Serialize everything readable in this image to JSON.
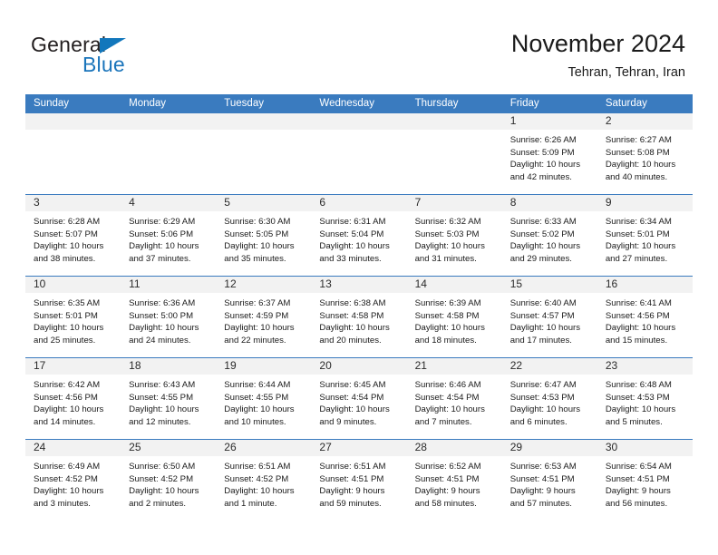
{
  "logo": {
    "word_one": "General",
    "word_two": "Blue",
    "triangle_icon": "blue-triangle-icon",
    "color_dark": "#231f20",
    "color_blue": "#1b75bb"
  },
  "header": {
    "title": "November 2024",
    "subtitle": "Tehran, Tehran, Iran",
    "accent_color": "#3a7bbf",
    "datenum_bg": "#f2f2f2"
  },
  "weekdays": [
    "Sunday",
    "Monday",
    "Tuesday",
    "Wednesday",
    "Thursday",
    "Friday",
    "Saturday"
  ],
  "labels": {
    "sunrise": "Sunrise:",
    "sunset": "Sunset:",
    "daylight": "Daylight:"
  },
  "weeks": [
    [
      {
        "day": "",
        "empty": true
      },
      {
        "day": "",
        "empty": true
      },
      {
        "day": "",
        "empty": true
      },
      {
        "day": "",
        "empty": true
      },
      {
        "day": "",
        "empty": true
      },
      {
        "day": "1",
        "sunrise": "Sunrise: 6:26 AM",
        "sunset": "Sunset: 5:09 PM",
        "daylight": "Daylight: 10 hours and 42 minutes."
      },
      {
        "day": "2",
        "sunrise": "Sunrise: 6:27 AM",
        "sunset": "Sunset: 5:08 PM",
        "daylight": "Daylight: 10 hours and 40 minutes."
      }
    ],
    [
      {
        "day": "3",
        "sunrise": "Sunrise: 6:28 AM",
        "sunset": "Sunset: 5:07 PM",
        "daylight": "Daylight: 10 hours and 38 minutes."
      },
      {
        "day": "4",
        "sunrise": "Sunrise: 6:29 AM",
        "sunset": "Sunset: 5:06 PM",
        "daylight": "Daylight: 10 hours and 37 minutes."
      },
      {
        "day": "5",
        "sunrise": "Sunrise: 6:30 AM",
        "sunset": "Sunset: 5:05 PM",
        "daylight": "Daylight: 10 hours and 35 minutes."
      },
      {
        "day": "6",
        "sunrise": "Sunrise: 6:31 AM",
        "sunset": "Sunset: 5:04 PM",
        "daylight": "Daylight: 10 hours and 33 minutes."
      },
      {
        "day": "7",
        "sunrise": "Sunrise: 6:32 AM",
        "sunset": "Sunset: 5:03 PM",
        "daylight": "Daylight: 10 hours and 31 minutes."
      },
      {
        "day": "8",
        "sunrise": "Sunrise: 6:33 AM",
        "sunset": "Sunset: 5:02 PM",
        "daylight": "Daylight: 10 hours and 29 minutes."
      },
      {
        "day": "9",
        "sunrise": "Sunrise: 6:34 AM",
        "sunset": "Sunset: 5:01 PM",
        "daylight": "Daylight: 10 hours and 27 minutes."
      }
    ],
    [
      {
        "day": "10",
        "sunrise": "Sunrise: 6:35 AM",
        "sunset": "Sunset: 5:01 PM",
        "daylight": "Daylight: 10 hours and 25 minutes."
      },
      {
        "day": "11",
        "sunrise": "Sunrise: 6:36 AM",
        "sunset": "Sunset: 5:00 PM",
        "daylight": "Daylight: 10 hours and 24 minutes."
      },
      {
        "day": "12",
        "sunrise": "Sunrise: 6:37 AM",
        "sunset": "Sunset: 4:59 PM",
        "daylight": "Daylight: 10 hours and 22 minutes."
      },
      {
        "day": "13",
        "sunrise": "Sunrise: 6:38 AM",
        "sunset": "Sunset: 4:58 PM",
        "daylight": "Daylight: 10 hours and 20 minutes."
      },
      {
        "day": "14",
        "sunrise": "Sunrise: 6:39 AM",
        "sunset": "Sunset: 4:58 PM",
        "daylight": "Daylight: 10 hours and 18 minutes."
      },
      {
        "day": "15",
        "sunrise": "Sunrise: 6:40 AM",
        "sunset": "Sunset: 4:57 PM",
        "daylight": "Daylight: 10 hours and 17 minutes."
      },
      {
        "day": "16",
        "sunrise": "Sunrise: 6:41 AM",
        "sunset": "Sunset: 4:56 PM",
        "daylight": "Daylight: 10 hours and 15 minutes."
      }
    ],
    [
      {
        "day": "17",
        "sunrise": "Sunrise: 6:42 AM",
        "sunset": "Sunset: 4:56 PM",
        "daylight": "Daylight: 10 hours and 14 minutes."
      },
      {
        "day": "18",
        "sunrise": "Sunrise: 6:43 AM",
        "sunset": "Sunset: 4:55 PM",
        "daylight": "Daylight: 10 hours and 12 minutes."
      },
      {
        "day": "19",
        "sunrise": "Sunrise: 6:44 AM",
        "sunset": "Sunset: 4:55 PM",
        "daylight": "Daylight: 10 hours and 10 minutes."
      },
      {
        "day": "20",
        "sunrise": "Sunrise: 6:45 AM",
        "sunset": "Sunset: 4:54 PM",
        "daylight": "Daylight: 10 hours and 9 minutes."
      },
      {
        "day": "21",
        "sunrise": "Sunrise: 6:46 AM",
        "sunset": "Sunset: 4:54 PM",
        "daylight": "Daylight: 10 hours and 7 minutes."
      },
      {
        "day": "22",
        "sunrise": "Sunrise: 6:47 AM",
        "sunset": "Sunset: 4:53 PM",
        "daylight": "Daylight: 10 hours and 6 minutes."
      },
      {
        "day": "23",
        "sunrise": "Sunrise: 6:48 AM",
        "sunset": "Sunset: 4:53 PM",
        "daylight": "Daylight: 10 hours and 5 minutes."
      }
    ],
    [
      {
        "day": "24",
        "sunrise": "Sunrise: 6:49 AM",
        "sunset": "Sunset: 4:52 PM",
        "daylight": "Daylight: 10 hours and 3 minutes."
      },
      {
        "day": "25",
        "sunrise": "Sunrise: 6:50 AM",
        "sunset": "Sunset: 4:52 PM",
        "daylight": "Daylight: 10 hours and 2 minutes."
      },
      {
        "day": "26",
        "sunrise": "Sunrise: 6:51 AM",
        "sunset": "Sunset: 4:52 PM",
        "daylight": "Daylight: 10 hours and 1 minute."
      },
      {
        "day": "27",
        "sunrise": "Sunrise: 6:51 AM",
        "sunset": "Sunset: 4:51 PM",
        "daylight": "Daylight: 9 hours and 59 minutes."
      },
      {
        "day": "28",
        "sunrise": "Sunrise: 6:52 AM",
        "sunset": "Sunset: 4:51 PM",
        "daylight": "Daylight: 9 hours and 58 minutes."
      },
      {
        "day": "29",
        "sunrise": "Sunrise: 6:53 AM",
        "sunset": "Sunset: 4:51 PM",
        "daylight": "Daylight: 9 hours and 57 minutes."
      },
      {
        "day": "30",
        "sunrise": "Sunrise: 6:54 AM",
        "sunset": "Sunset: 4:51 PM",
        "daylight": "Daylight: 9 hours and 56 minutes."
      }
    ]
  ]
}
